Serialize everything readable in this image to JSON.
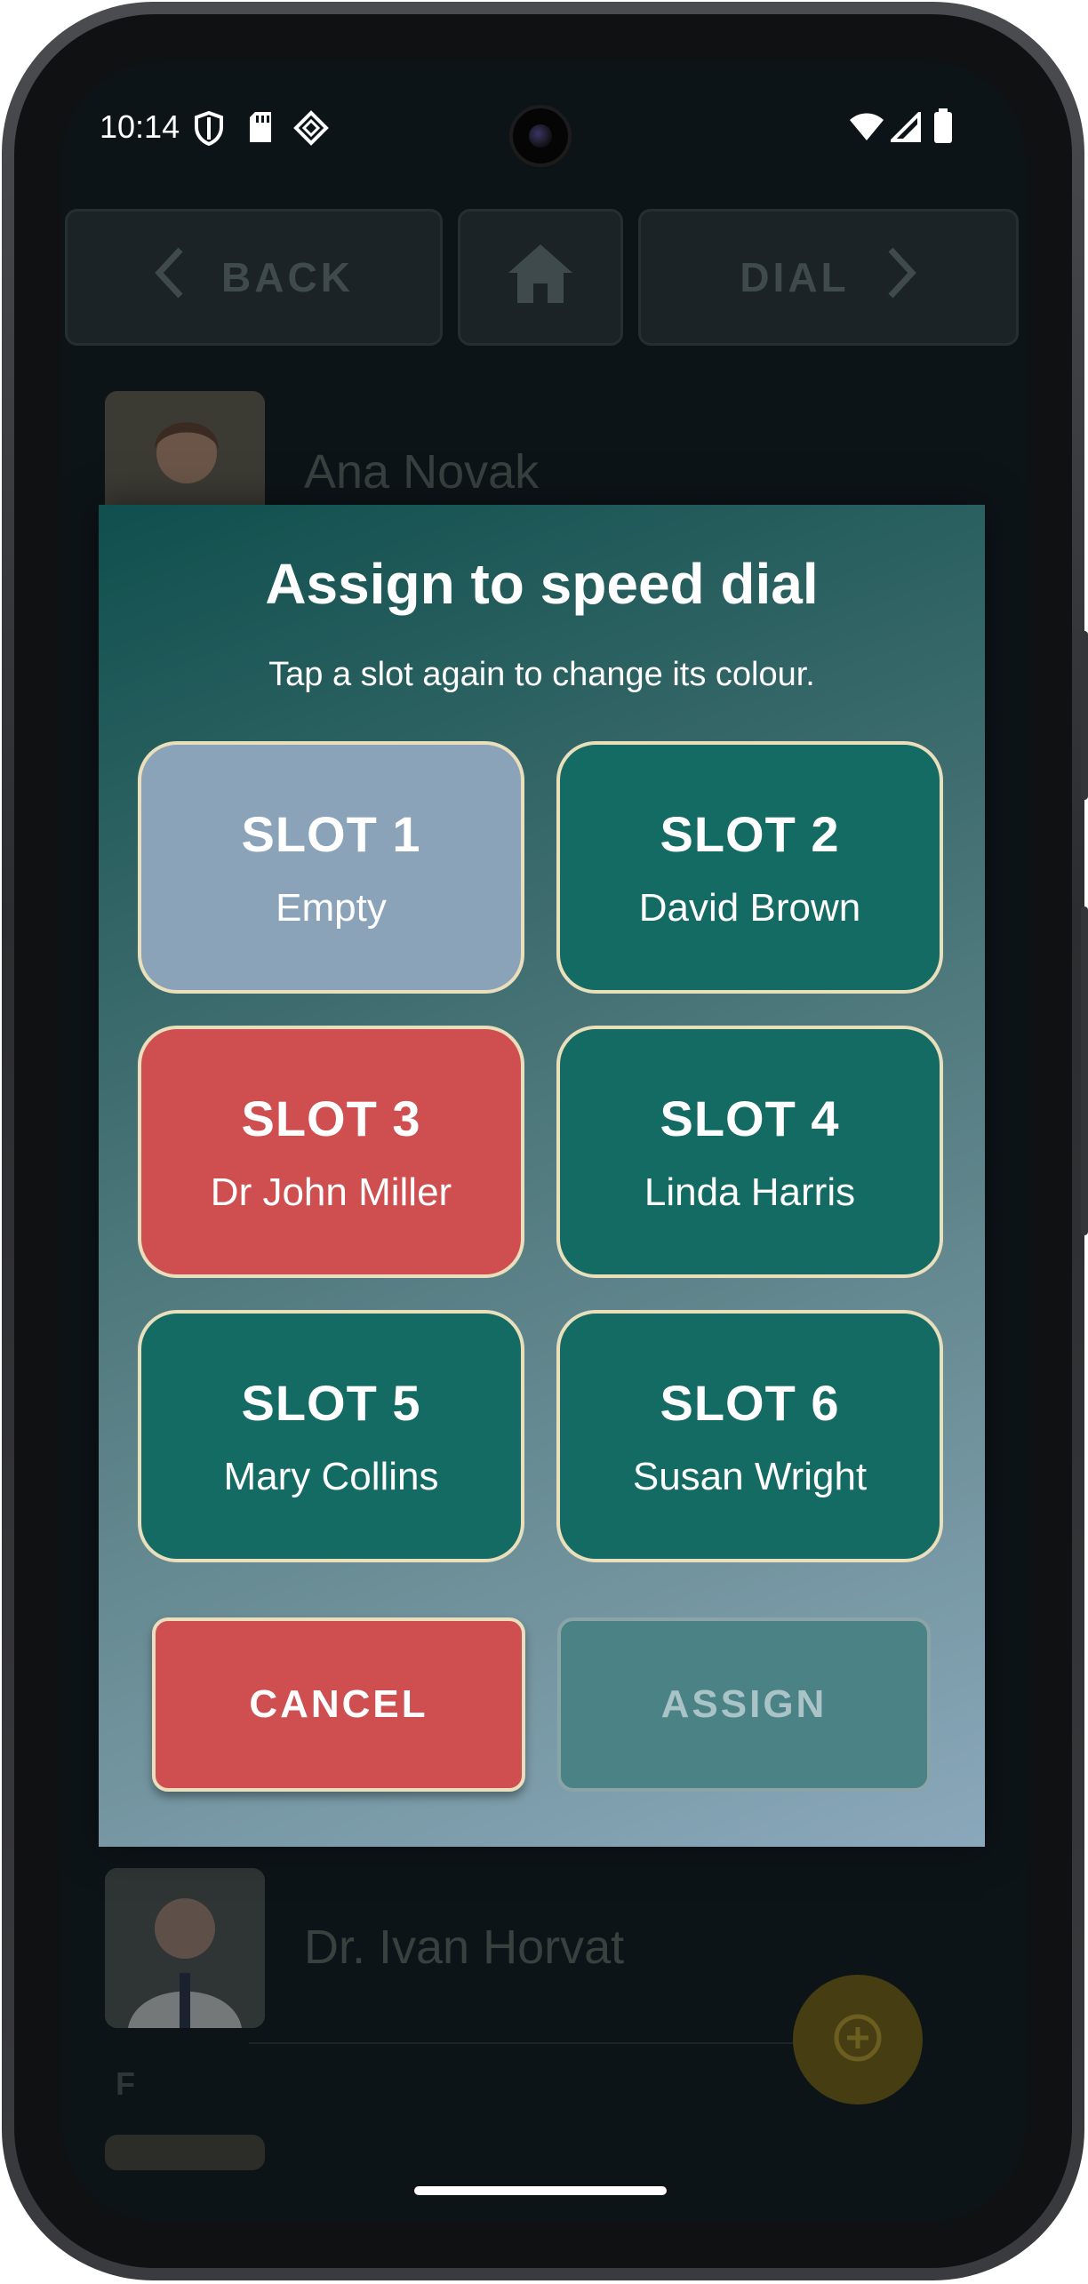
{
  "status_bar": {
    "time": "10:14"
  },
  "background": {
    "back_label": "BACK",
    "dial_label": "DIAL",
    "contacts": [
      {
        "name": "Ana Novak"
      },
      {
        "name": "Dr. Ivan Horvat"
      }
    ],
    "section_letter": "F"
  },
  "dialog": {
    "title": "Assign to speed dial",
    "subtitle": "Tap a slot again to change its colour.",
    "slots": [
      {
        "label": "SLOT 1",
        "name": "Empty",
        "color": "#8ba3b9"
      },
      {
        "label": "SLOT 2",
        "name": "David Brown",
        "color": "#146b64"
      },
      {
        "label": "SLOT 3",
        "name": "Dr John Miller",
        "color": "#cf4f50"
      },
      {
        "label": "SLOT 4",
        "name": "Linda Harris",
        "color": "#146b64"
      },
      {
        "label": "SLOT 5",
        "name": "Mary Collins",
        "color": "#146b64"
      },
      {
        "label": "SLOT 6",
        "name": "Susan Wright",
        "color": "#146b64"
      }
    ],
    "cancel_label": "CANCEL",
    "assign_label": "ASSIGN"
  },
  "colors": {
    "cancel": "#cf4f50",
    "assign_disabled": "#4a8285",
    "slot_border": "#e9dfbd",
    "fab": "#463e12"
  }
}
